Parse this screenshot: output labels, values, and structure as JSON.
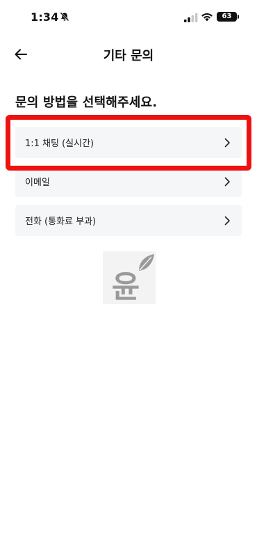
{
  "status_bar": {
    "time": "1:34",
    "battery": "63"
  },
  "header": {
    "title": "기타 문의"
  },
  "heading": "문의 방법을 선택해주세요.",
  "options": [
    {
      "label": "1:1 채팅 (실시간)"
    },
    {
      "label": "이메일"
    },
    {
      "label": "전화 (통화료 부과)"
    }
  ],
  "colors": {
    "highlight": "#ee1111",
    "option_bg": "#f5f6f8"
  },
  "logo": {
    "glyph": "윤"
  }
}
